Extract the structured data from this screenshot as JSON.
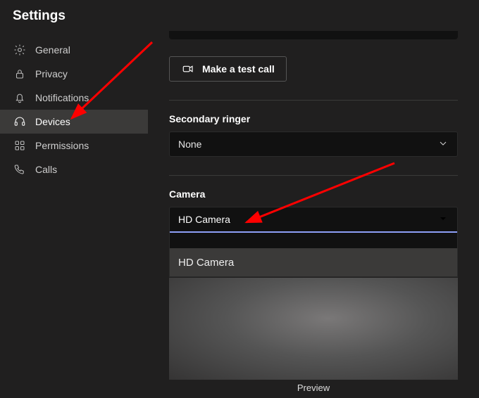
{
  "title": "Settings",
  "sidebar": {
    "items": [
      {
        "label": "General"
      },
      {
        "label": "Privacy"
      },
      {
        "label": "Notifications"
      },
      {
        "label": "Devices"
      },
      {
        "label": "Permissions"
      },
      {
        "label": "Calls"
      }
    ]
  },
  "main": {
    "test_call_label": "Make a test call",
    "secondary_ringer": {
      "label": "Secondary ringer",
      "value": "None"
    },
    "camera": {
      "label": "Camera",
      "value": "HD Camera",
      "option": "HD Camera",
      "preview_label": "Preview"
    }
  },
  "annotation": {
    "arrow_color": "#ff0000"
  }
}
